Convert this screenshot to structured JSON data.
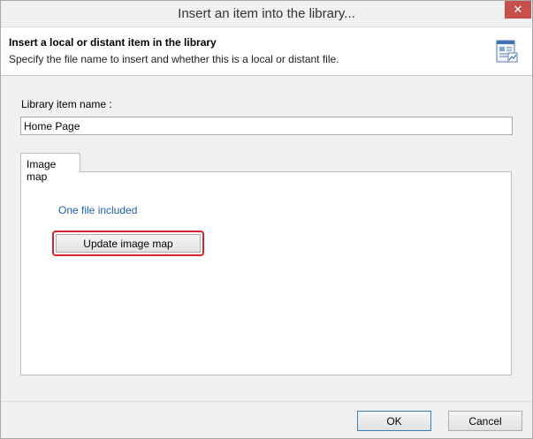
{
  "window": {
    "title": "Insert an item into the library...",
    "close_glyph": "✕"
  },
  "header": {
    "title": "Insert a local or distant item in the library",
    "subtitle": "Specify the file name to insert and whether this is a local or distant file.",
    "icon": "library-document-icon"
  },
  "form": {
    "name_label": "Library item name :",
    "name_value": "Home Page"
  },
  "tabs": [
    {
      "label": "Image map"
    }
  ],
  "panel": {
    "info": "One file included",
    "update_label": "Update image map"
  },
  "footer": {
    "ok_label": "OK",
    "cancel_label": "Cancel"
  },
  "colors": {
    "close_button": "#c7504a",
    "info_text": "#1e5fa8",
    "highlight": "#d9232d"
  }
}
